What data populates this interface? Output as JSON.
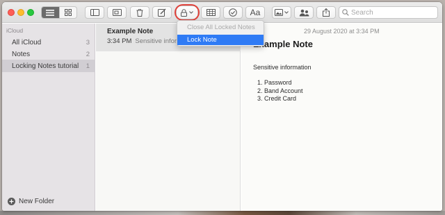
{
  "toolbar": {
    "search_placeholder": "Search",
    "format_label": "Aa"
  },
  "sidebar": {
    "header": "iCloud",
    "items": [
      {
        "label": "All iCloud",
        "count": "3"
      },
      {
        "label": "Notes",
        "count": "2"
      },
      {
        "label": "Locking Notes tutorial",
        "count": "1"
      }
    ],
    "new_folder": "New Folder"
  },
  "note_list": {
    "notes": [
      {
        "title": "Example Note",
        "time": "3:34 PM",
        "snippet": "Sensitive information"
      }
    ]
  },
  "editor": {
    "date": "29 August 2020 at 3:34 PM",
    "title": "Example Note",
    "intro": "Sensitive information",
    "items": [
      "1.  Password",
      "2.  Band Account",
      "3.  Credit Card"
    ]
  },
  "lock_menu": {
    "items": [
      {
        "label": "Close All Locked Notes",
        "enabled": false
      },
      {
        "label": "Lock Note",
        "enabled": true,
        "highlighted": true
      }
    ]
  },
  "colors": {
    "highlight": "#2f7bf5",
    "callout_ring": "#e0413a"
  }
}
